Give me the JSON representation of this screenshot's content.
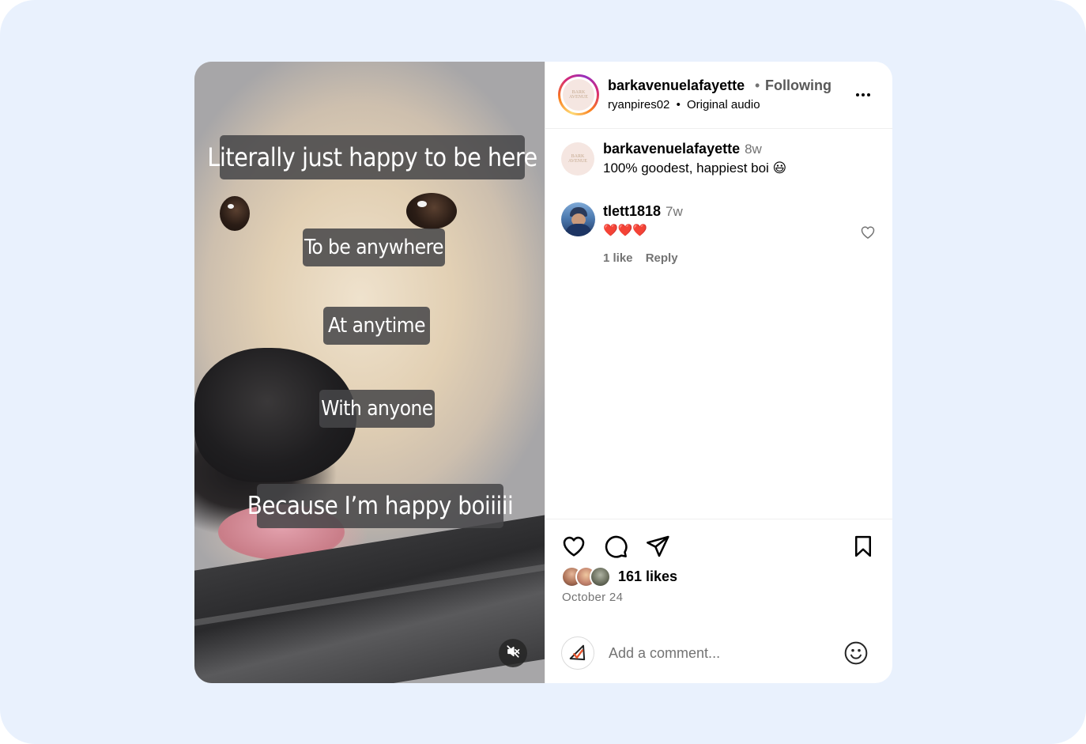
{
  "post": {
    "captions": [
      "Literally just happy to be here",
      "To be anywhere",
      "At anytime",
      "With anyone",
      "Because I’m happy boiiiii"
    ],
    "mute_icon": "speaker-muted-icon"
  },
  "header": {
    "username": "barkavenuelafayette",
    "separator": "•",
    "follow_status": "Following",
    "audio_user": "ryanpires02",
    "audio_separator": "•",
    "audio_label": "Original audio",
    "more_icon": "more-options-icon"
  },
  "comments": [
    {
      "username": "barkavenuelafayette",
      "time": "8w",
      "text": "100% goodest, happiest boi 😃"
    },
    {
      "username": "tlett1818",
      "time": "7w",
      "text": "❤️❤️❤️",
      "likes_label": "1 like",
      "reply_label": "Reply"
    }
  ],
  "actions": {
    "like_icon": "heart-icon",
    "comment_icon": "comment-icon",
    "share_icon": "send-icon",
    "save_icon": "bookmark-icon",
    "likes_count": "161 likes",
    "date": "October 24"
  },
  "add_comment": {
    "placeholder": "Add a comment...",
    "emoji_icon": "emoji-icon"
  },
  "logo_text": "BARK AVENUE"
}
